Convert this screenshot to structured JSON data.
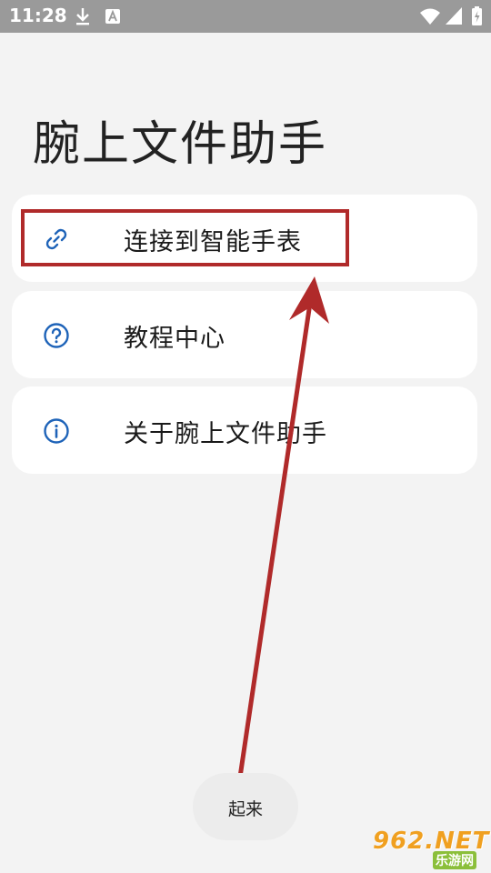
{
  "status_bar": {
    "time": "11:28",
    "icons": [
      "download-icon",
      "a-notification-icon",
      "wifi-icon",
      "signal-icon",
      "battery-icon"
    ]
  },
  "app": {
    "title": "腕上文件助手"
  },
  "menu": [
    {
      "icon": "link-icon",
      "label": "连接到智能手表"
    },
    {
      "icon": "help-circle-icon",
      "label": "教程中心"
    },
    {
      "icon": "info-circle-icon",
      "label": "关于腕上文件助手"
    }
  ],
  "bottom_button": {
    "label": "起来"
  },
  "watermark": {
    "brand": "962.NET",
    "subtitle": "乐游网"
  },
  "colors": {
    "accent_icon": "#1e63b8",
    "annotation_red": "#b02a2a",
    "status_bar_bg": "#9a9a9a",
    "page_bg": "#f3f3f3"
  }
}
